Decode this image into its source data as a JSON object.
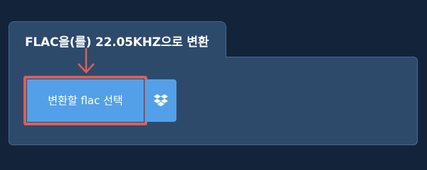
{
  "tab": {
    "title": "FLAC을(를) 22.05KHZ으로 변환"
  },
  "upload": {
    "choose_label": "변환할 flac 선택",
    "dropbox_icon": "dropbox-icon"
  },
  "colors": {
    "background": "#13243a",
    "panel": "#2e4a6b",
    "button": "#53a0e8",
    "highlight": "#d9605a"
  }
}
